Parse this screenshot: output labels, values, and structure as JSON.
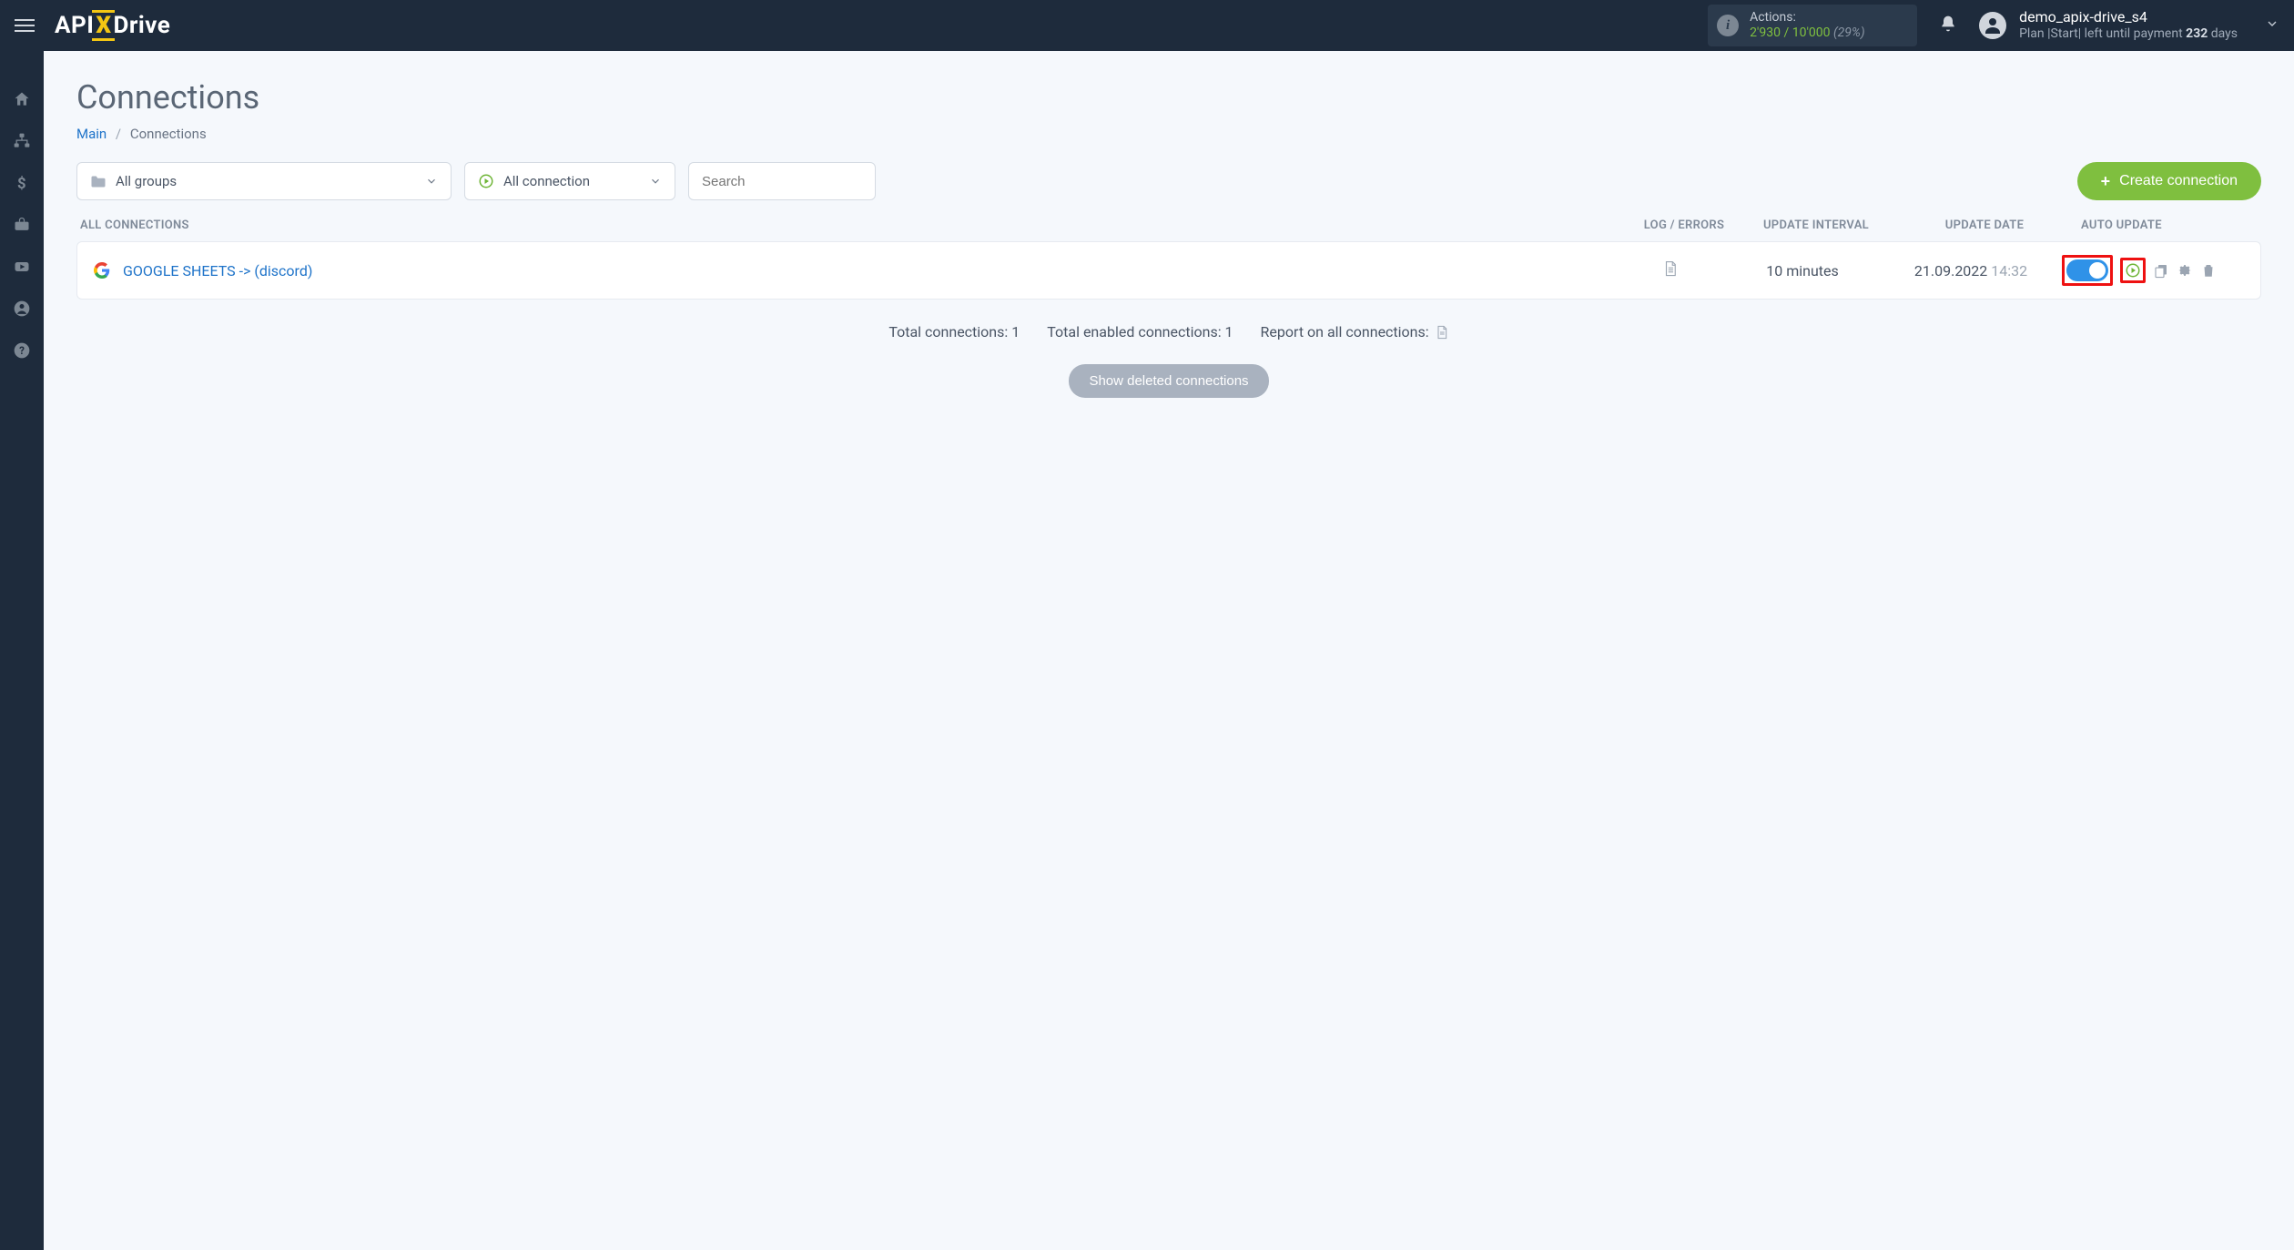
{
  "topbar": {
    "logo_pre": "API",
    "logo_x": "X",
    "logo_post": "Drive",
    "actions_label": "Actions:",
    "actions_used": "2'930",
    "actions_sep": " / ",
    "actions_total": "10'000",
    "actions_pct": "(29%)",
    "user_name": "demo_apix-drive_s4",
    "user_sub_pre": "Plan |Start| left until payment ",
    "user_sub_days": "232",
    "user_sub_post": " days"
  },
  "page": {
    "title": "Connections",
    "breadcrumb_main": "Main",
    "breadcrumb_current": "Connections"
  },
  "filters": {
    "groups": "All groups",
    "connection": "All connection",
    "search_placeholder": "Search",
    "create_btn": "Create connection"
  },
  "table": {
    "headers": {
      "name": "ALL CONNECTIONS",
      "log": "LOG / ERRORS",
      "interval": "UPDATE INTERVAL",
      "date": "UPDATE DATE",
      "auto": "AUTO UPDATE"
    },
    "rows": [
      {
        "name": "GOOGLE SHEETS -> (discord)",
        "interval": "10 minutes",
        "date": "21.09.2022",
        "time": "14:32",
        "auto_on": true
      }
    ]
  },
  "summary": {
    "total_label": "Total connections: ",
    "total_value": "1",
    "enabled_label": "Total enabled connections: ",
    "enabled_value": "1",
    "report_label": "Report on all connections:"
  },
  "show_deleted": "Show deleted connections"
}
